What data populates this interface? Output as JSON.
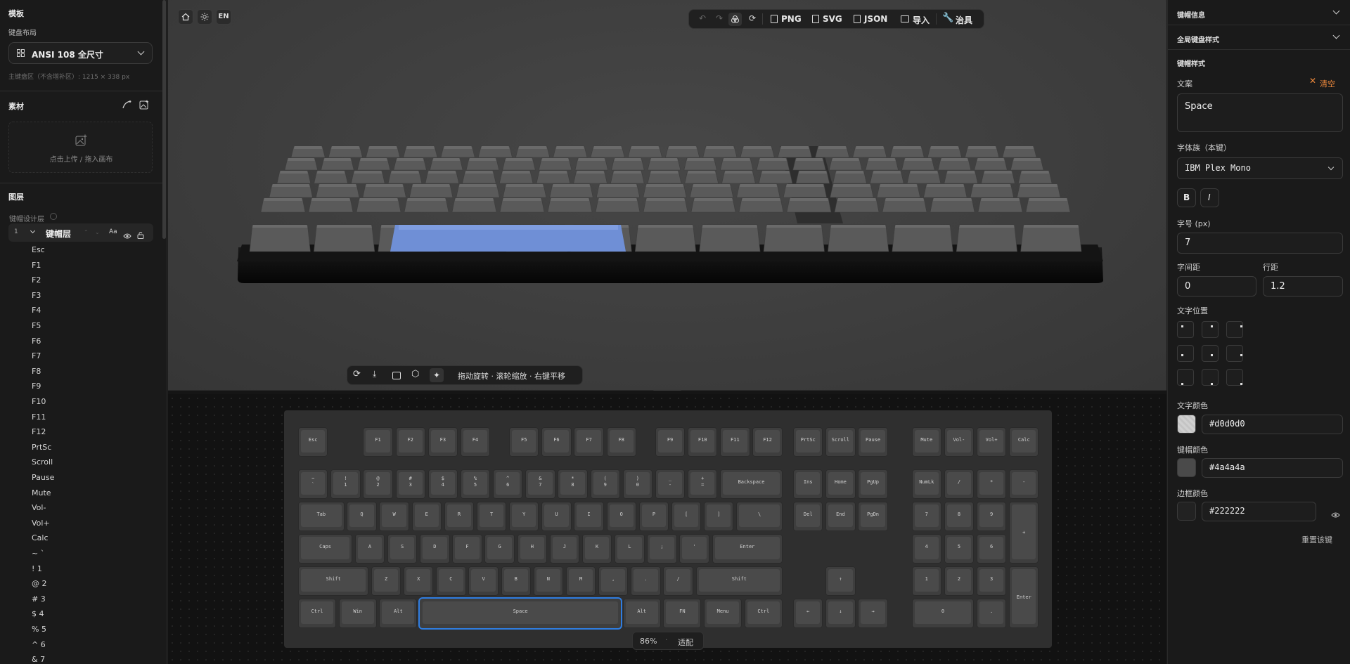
{
  "left": {
    "template_title": "模板",
    "layout_label": "键盘布局",
    "layout_value": "ANSI 108 全尺寸",
    "layout_dims": "主键盘区（不含增补区）: 1215 × 338 px",
    "materials_title": "素材",
    "upload_hint": "点击上传 / 拖入画布",
    "layers_title": "图层",
    "layer_group_label": "键帽设计层",
    "layer_row_index": "1",
    "layer_row_name": "键帽层",
    "layer_row_aa": "Aa",
    "tree_items": [
      "Esc",
      "F1",
      "F2",
      "F3",
      "F4",
      "F5",
      "F6",
      "F7",
      "F8",
      "F9",
      "F10",
      "F11",
      "F12",
      "PrtSc",
      "Scroll",
      "Pause",
      "Mute",
      "Vol-",
      "Vol+",
      "Calc",
      "~ `",
      "! 1",
      "@ 2",
      "# 3",
      "$ 4",
      "% 5",
      "^ 6",
      "& 7"
    ]
  },
  "viewport": {
    "lang": "EN",
    "toolbar": {
      "png": "PNG",
      "svg": "SVG",
      "json": "JSON",
      "import": "导入",
      "jig": "治具"
    },
    "hint": "拖动旋转 · 滚轮缩放 · 右键平移"
  },
  "canvas": {
    "zoom": "86%",
    "fit": "适配",
    "rows": [
      [
        "Esc",
        "F1",
        "F2",
        "F3",
        "F4",
        "F5",
        "F6",
        "F7",
        "F8",
        "F9",
        "F10",
        "F11",
        "F12",
        "PrtSc",
        "Scroll",
        "Pause",
        "Mute",
        "Vol-",
        "Vol+",
        "Calc"
      ],
      [
        "~",
        "!",
        "@",
        "#",
        "$",
        "%",
        "^",
        "&",
        "*",
        "(",
        ")",
        "_",
        "+",
        "Backspace",
        "Ins",
        "Home",
        "PgUp",
        "NumLk",
        "/",
        "*",
        "-"
      ],
      [
        "Tab",
        "Q",
        "W",
        "E",
        "R",
        "T",
        "Y",
        "U",
        "I",
        "O",
        "P",
        "[",
        "]",
        "\\",
        "Del",
        "End",
        "PgDn",
        "7",
        "8",
        "9",
        "+"
      ],
      [
        "Caps",
        "A",
        "S",
        "D",
        "F",
        "G",
        "H",
        "J",
        "K",
        "L",
        ";",
        "'",
        "Enter",
        "4",
        "5",
        "6"
      ],
      [
        "Shift",
        "Z",
        "X",
        "C",
        "V",
        "B",
        "N",
        "M",
        ",",
        ".",
        "/",
        "Shift",
        "↑",
        "1",
        "2",
        "3",
        "Enter"
      ],
      [
        "Ctrl",
        "Win",
        "Alt",
        "Space",
        "Alt",
        "FN",
        "Menu",
        "Ctrl",
        "←",
        "↓",
        "→",
        "0",
        "."
      ]
    ],
    "row2_sub": [
      "`",
      "1",
      "2",
      "3",
      "4",
      "5",
      "6",
      "7",
      "8",
      "9",
      "0",
      "-",
      "="
    ]
  },
  "right": {
    "keycap_info": "键帽信息",
    "global_style": "全局键盘样式",
    "keycap_style": "键帽样式",
    "text_label": "文案",
    "clear_label": "清空",
    "text_value": "Space",
    "font_family_label": "字体族（本键）",
    "font_family_value": "IBM Plex Mono",
    "bold": "B",
    "italic": "I",
    "font_size_label": "字号 (px)",
    "font_size_value": "7",
    "letter_spacing_label": "字间距",
    "letter_spacing_value": "0",
    "line_height_label": "行距",
    "line_height_value": "1.2",
    "text_position_label": "文字位置",
    "text_color_label": "文字颜色",
    "text_color_value": "#d0d0d0",
    "keycap_color_label": "键帽颜色",
    "keycap_color_value": "#4a4a4a",
    "border_color_label": "边框颜色",
    "border_color_value": "#222222",
    "reset_label": "重置该键"
  },
  "colors": {
    "accent": "#2f7de1",
    "clear": "#f08a3c",
    "selected_3d": "#6f8fd6"
  }
}
